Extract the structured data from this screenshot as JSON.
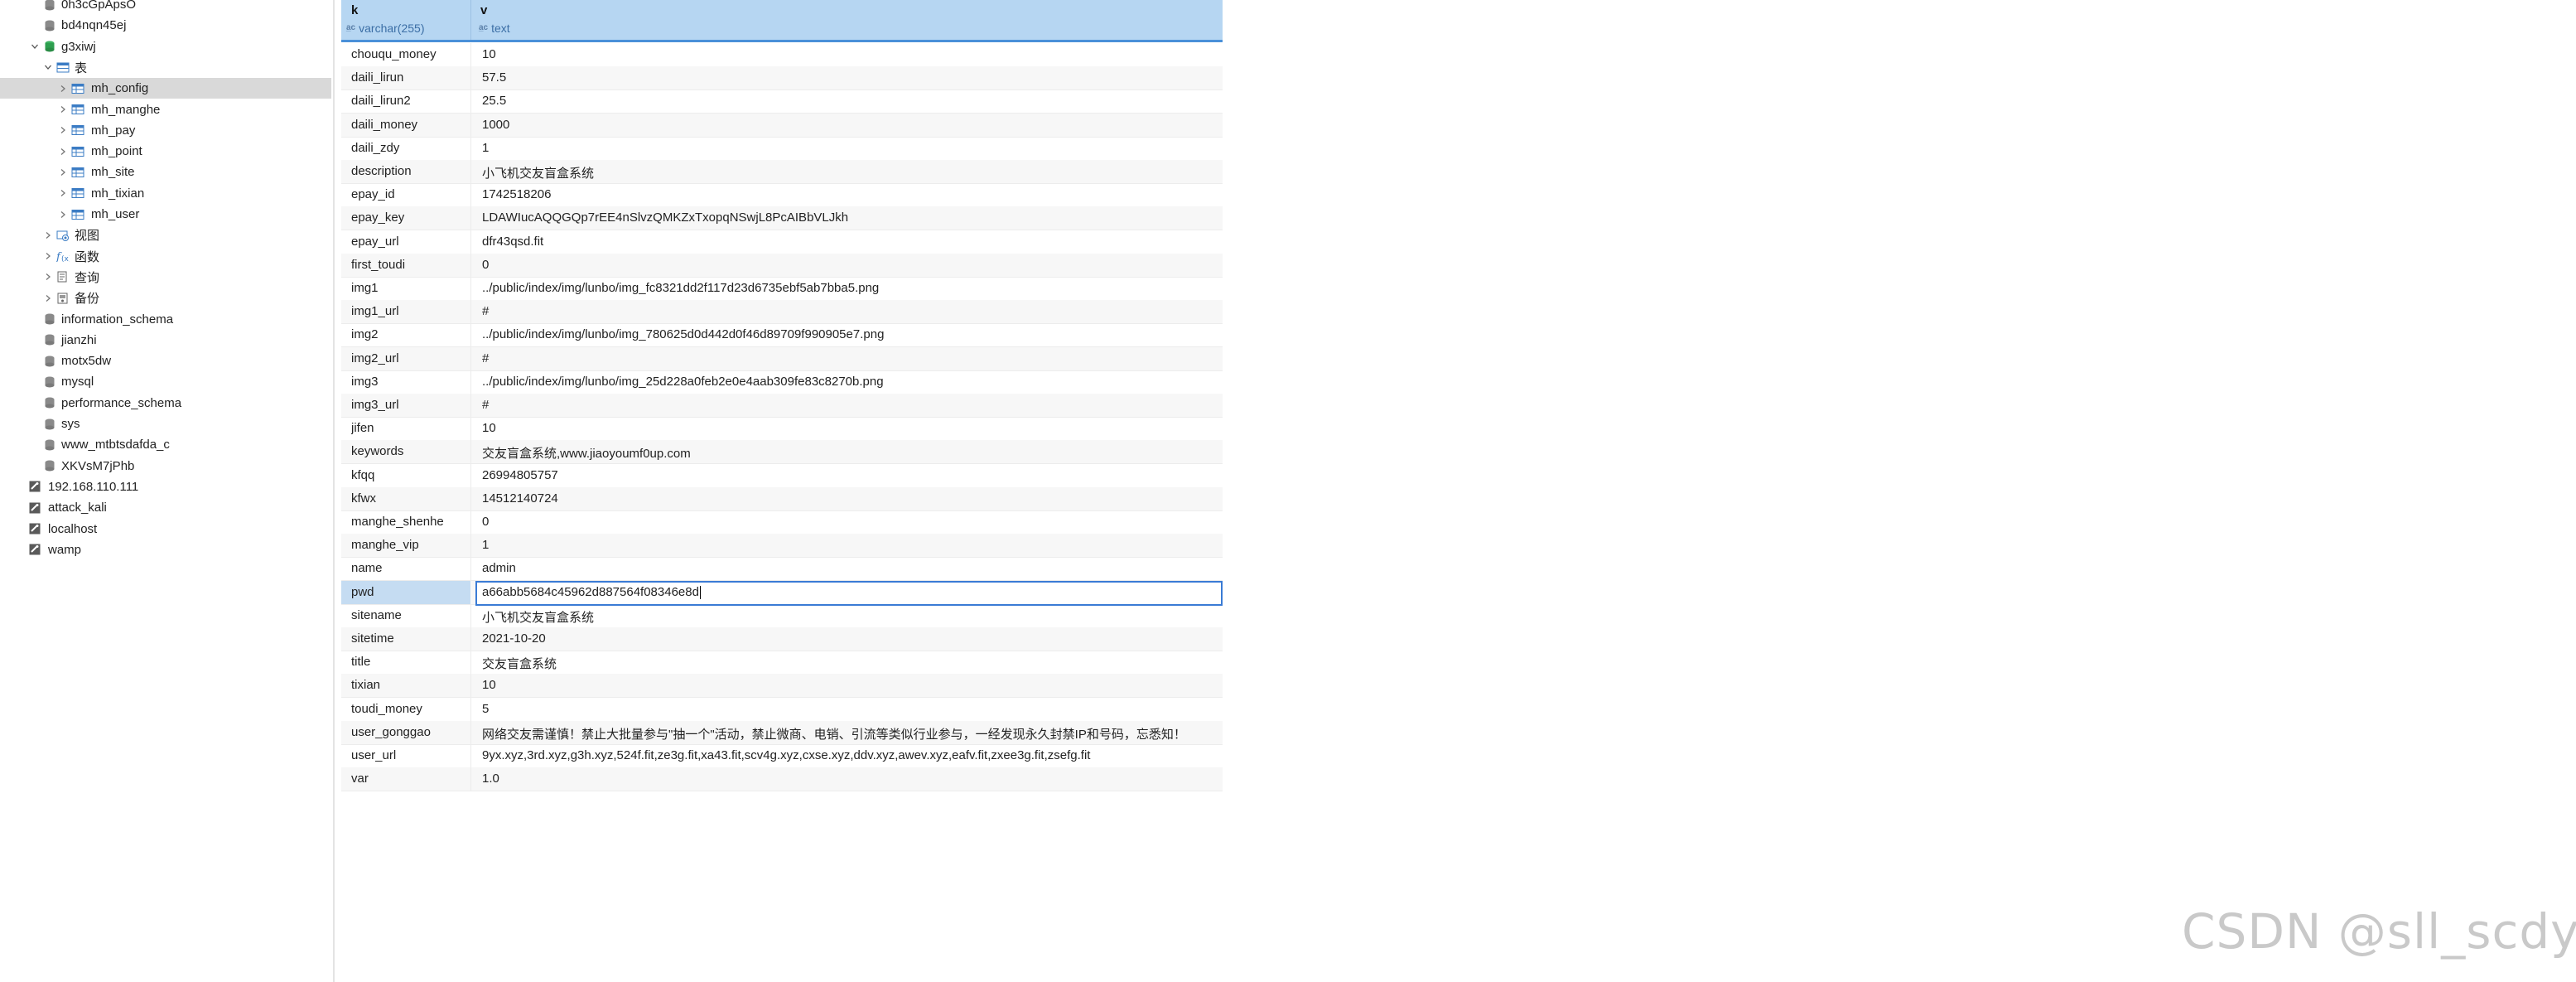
{
  "sidebar": {
    "items": [
      {
        "label": "0h3cGpApsO",
        "kind": "db-gray"
      },
      {
        "label": "bd4nqn45ej",
        "kind": "db-gray"
      },
      {
        "label": "g3xiwj",
        "kind": "db-green",
        "expanded": true
      },
      {
        "label": "表",
        "kind": "folder-table",
        "expanded": true
      },
      {
        "label": "mh_config",
        "kind": "table",
        "selected": true
      },
      {
        "label": "mh_manghe",
        "kind": "table"
      },
      {
        "label": "mh_pay",
        "kind": "table"
      },
      {
        "label": "mh_point",
        "kind": "table"
      },
      {
        "label": "mh_site",
        "kind": "table"
      },
      {
        "label": "mh_tixian",
        "kind": "table"
      },
      {
        "label": "mh_user",
        "kind": "table"
      },
      {
        "label": "视图",
        "kind": "folder-view"
      },
      {
        "label": "函数",
        "kind": "folder-function"
      },
      {
        "label": "查询",
        "kind": "folder-query"
      },
      {
        "label": "备份",
        "kind": "folder-backup"
      },
      {
        "label": "information_schema",
        "kind": "db-gray"
      },
      {
        "label": "jianzhi",
        "kind": "db-gray"
      },
      {
        "label": "motx5dw",
        "kind": "db-gray"
      },
      {
        "label": "mysql",
        "kind": "db-gray"
      },
      {
        "label": "performance_schema",
        "kind": "db-gray"
      },
      {
        "label": "sys",
        "kind": "db-gray"
      },
      {
        "label": "www_mtbtsdafda_c",
        "kind": "db-gray"
      },
      {
        "label": "XKVsM7jPhb",
        "kind": "db-gray"
      },
      {
        "label": "192.168.110.111",
        "kind": "connection"
      },
      {
        "label": "attack_kali",
        "kind": "connection"
      },
      {
        "label": "localhost",
        "kind": "connection"
      },
      {
        "label": "wamp",
        "kind": "connection"
      }
    ]
  },
  "grid": {
    "columns": [
      {
        "name": "k",
        "type": "varchar(255)"
      },
      {
        "name": "v",
        "type": "text"
      }
    ],
    "rows": [
      {
        "k": "chouqu_money",
        "v": "10"
      },
      {
        "k": "daili_lirun",
        "v": "57.5"
      },
      {
        "k": "daili_lirun2",
        "v": "25.5"
      },
      {
        "k": "daili_money",
        "v": "1000"
      },
      {
        "k": "daili_zdy",
        "v": "1"
      },
      {
        "k": "description",
        "v": "小飞机交友盲盒系统"
      },
      {
        "k": "epay_id",
        "v": "1742518206"
      },
      {
        "k": "epay_key",
        "v": "LDAWIucAQQGQp7rEE4nSlvzQMKZxTxopqNSwjL8PcAIBbVLJkh"
      },
      {
        "k": "epay_url",
        "v": "dfr43qsd.fit"
      },
      {
        "k": "first_toudi",
        "v": "0"
      },
      {
        "k": "img1",
        "v": "../public/index/img/lunbo/img_fc8321dd2f117d23d6735ebf5ab7bba5.png"
      },
      {
        "k": "img1_url",
        "v": "#"
      },
      {
        "k": "img2",
        "v": "../public/index/img/lunbo/img_780625d0d442d0f46d89709f990905e7.png"
      },
      {
        "k": "img2_url",
        "v": "#"
      },
      {
        "k": "img3",
        "v": "../public/index/img/lunbo/img_25d228a0feb2e0e4aab309fe83c8270b.png"
      },
      {
        "k": "img3_url",
        "v": "#"
      },
      {
        "k": "jifen",
        "v": "10"
      },
      {
        "k": "keywords",
        "v": "交友盲盒系统,www.jiaoyoumf0up.com"
      },
      {
        "k": "kfqq",
        "v": "26994805757"
      },
      {
        "k": "kfwx",
        "v": "14512140724"
      },
      {
        "k": "manghe_shenhe",
        "v": "0"
      },
      {
        "k": "manghe_vip",
        "v": "1"
      },
      {
        "k": "name",
        "v": "admin"
      },
      {
        "k": "pwd",
        "v": "a66abb5684c45962d887564f08346e8d",
        "editing": true
      },
      {
        "k": "sitename",
        "v": "小飞机交友盲盒系统"
      },
      {
        "k": "sitetime",
        "v": "2021-10-20"
      },
      {
        "k": "title",
        "v": "交友盲盒系统"
      },
      {
        "k": "tixian",
        "v": "10"
      },
      {
        "k": "toudi_money",
        "v": "5"
      },
      {
        "k": "user_gonggao",
        "v": "网络交友需谨慎！禁止大批量参与\"抽一个\"活动，禁止微商、电销、引流等类似行业参与，一经发现永久封禁IP和号码，忘悉知！"
      },
      {
        "k": "user_url",
        "v": "9yx.xyz,3rd.xyz,g3h.xyz,524f.fit,ze3g.fit,xa43.fit,scv4g.xyz,cxse.xyz,ddv.xyz,awev.xyz,eafv.fit,zxee3g.fit,zsefg.fit"
      },
      {
        "k": "var",
        "v": "1.0"
      }
    ]
  },
  "watermark": "CSDN @sll_scdyh",
  "colors": {
    "header_bg": "#b6d6f2",
    "header_border": "#4a90d9",
    "selected_tree_row": "#d9d9d9",
    "edit_border": "#3a7bd5",
    "db_green": "#2e9e4f",
    "db_gray": "#8a8a8a"
  }
}
